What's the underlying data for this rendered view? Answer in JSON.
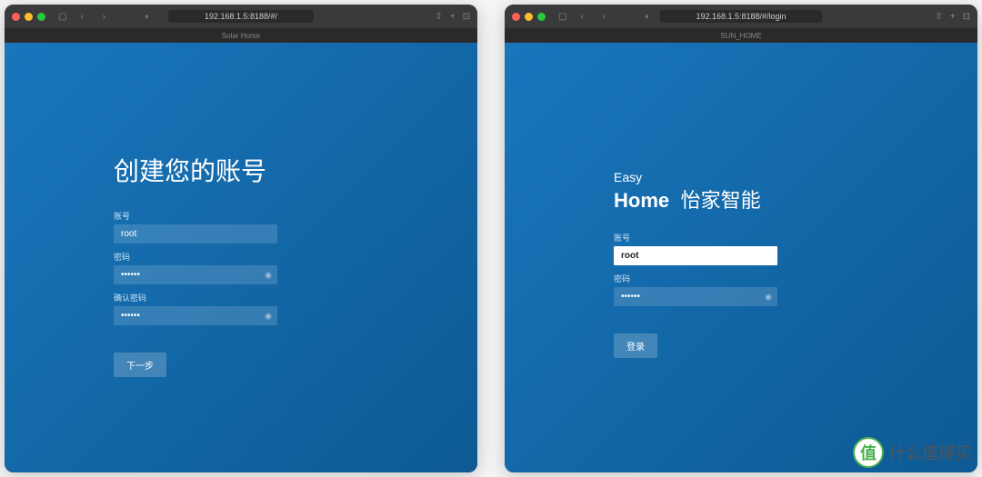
{
  "left": {
    "url": "192.168.1.5:8188/#/",
    "tab": "Solar Home",
    "heading": "创建您的账号",
    "account_label": "账号",
    "account_value": "root",
    "password_label": "密码",
    "password_value": "••••••",
    "confirm_label": "确认密码",
    "confirm_value": "••••••",
    "next_btn": "下一步"
  },
  "right": {
    "url": "192.168.1.5:8188/#/login",
    "tab": "SUN_HOME",
    "brand_top": "Easy",
    "brand_main": "Home",
    "brand_sub": "怡家智能",
    "account_label": "账号",
    "account_value": "root",
    "password_label": "密码",
    "password_value": "••••••",
    "login_btn": "登录"
  },
  "watermark": "什么值得买"
}
